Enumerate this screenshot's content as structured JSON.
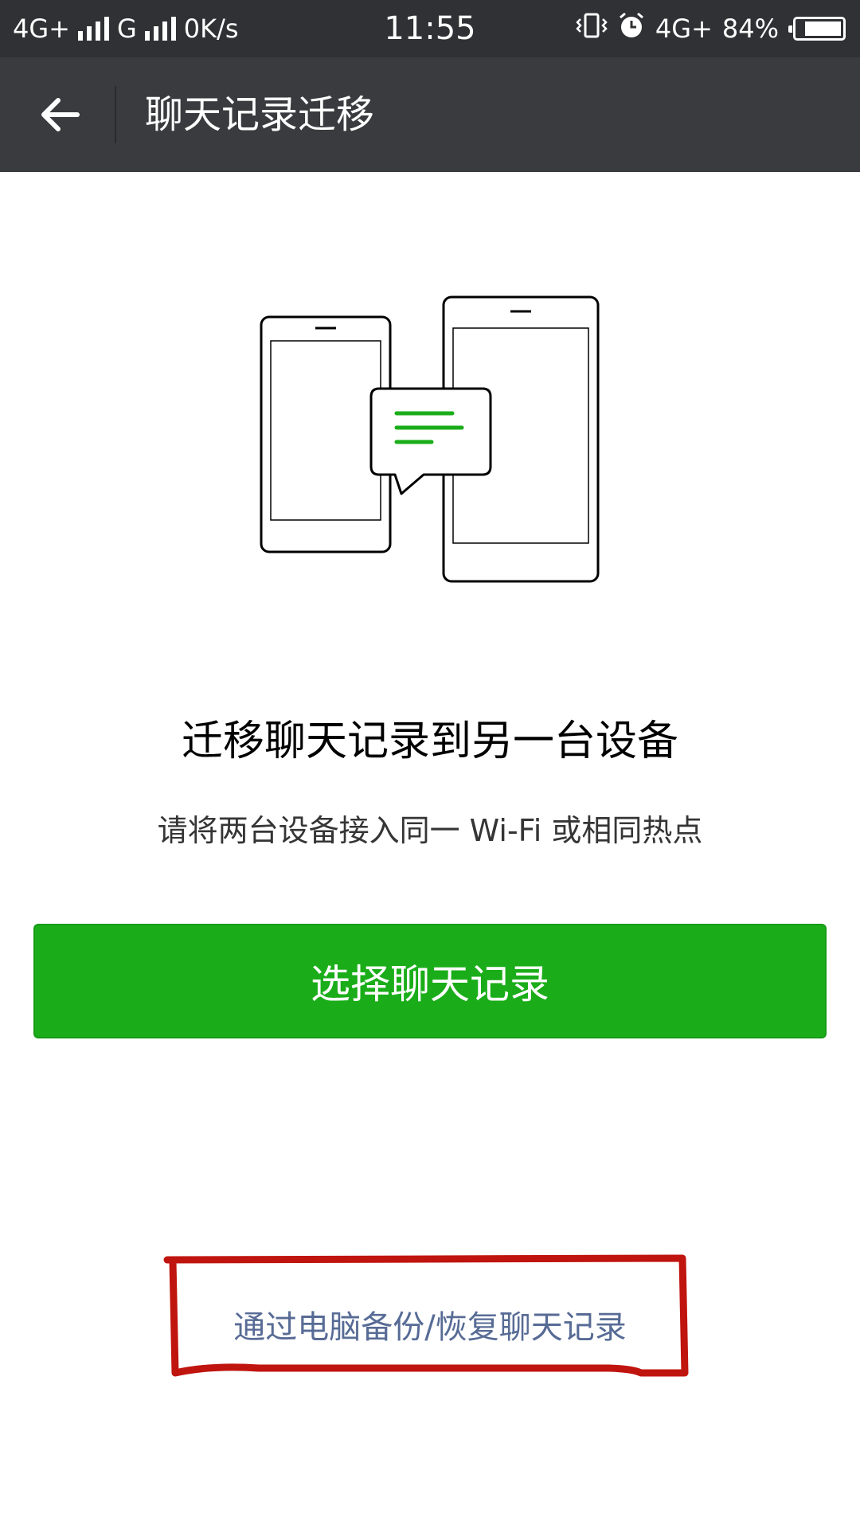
{
  "status_bar": {
    "network1": "4G+",
    "network2": "G",
    "speed": "0K/s",
    "time": "11:55",
    "network3": "4G+",
    "battery": "84%",
    "battery_level": 0.84
  },
  "app_bar": {
    "title": "聊天记录迁移"
  },
  "main": {
    "headline": "迁移聊天记录到另一台设备",
    "subtext": "请将两台设备接入同一 Wi-Fi 或相同热点",
    "primary_button": "选择聊天记录",
    "pc_link": "通过电脑备份/恢复聊天记录"
  },
  "colors": {
    "status_bar_bg": "#303134",
    "app_bar_bg": "#3a3b3e",
    "primary_green": "#1aad19",
    "link_blue": "#576b95",
    "annotation_red": "#c0140f"
  }
}
